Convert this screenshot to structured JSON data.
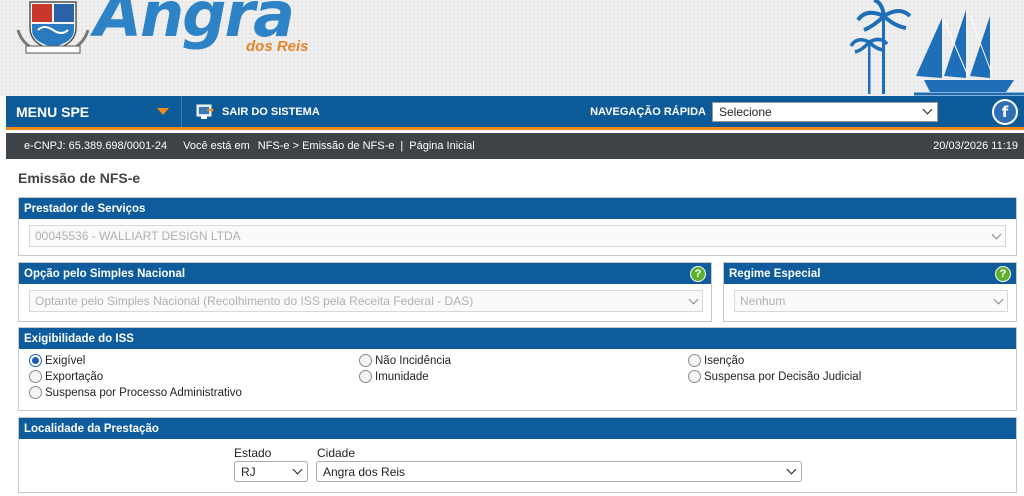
{
  "brand": {
    "name": "Angra",
    "subtitle": "dos Reis"
  },
  "nav": {
    "menu_label": "MENU SPE",
    "logout_label": "SAIR DO SISTEMA",
    "quick_nav_label": "NAVEGAÇÃO RÁPIDA",
    "quick_nav_value": "Selecione"
  },
  "status": {
    "cnpj": "e-CNPJ: 65.389.698/0001-24",
    "you_are_in": "Você está em",
    "breadcrumb": "NFS-e > Emissão de NFS-e",
    "separator": "|",
    "home": "Página Inicial",
    "datetime": "20/03/2026 11:19"
  },
  "page": {
    "title": "Emissão de NFS-e"
  },
  "prestador": {
    "heading": "Prestador de Serviços",
    "value": "00045536 - WALLIART DESIGN LTDA"
  },
  "simples": {
    "heading": "Opção pelo Simples Nacional",
    "value": "Optante pelo Simples Nacional (Recolhimento do ISS pela Receita Federal - DAS)"
  },
  "regime": {
    "heading": "Regime Especial",
    "value": "Nenhum"
  },
  "exigibilidade": {
    "heading": "Exigibilidade do ISS",
    "options": [
      {
        "label": "Exigível",
        "selected": true
      },
      {
        "label": "Não Incidência",
        "selected": false
      },
      {
        "label": "Isenção",
        "selected": false
      },
      {
        "label": "Exportação",
        "selected": false
      },
      {
        "label": "Imunidade",
        "selected": false
      },
      {
        "label": "Suspensa por Decisão Judicial",
        "selected": false
      },
      {
        "label": "Suspensa por Processo Administrativo",
        "selected": false
      }
    ]
  },
  "localidade": {
    "heading": "Localidade da Prestação",
    "estado_label": "Estado",
    "estado_value": "RJ",
    "cidade_label": "Cidade",
    "cidade_value": "Angra dos Reis"
  },
  "colors": {
    "primary": "#0e5c9c",
    "accent": "#f28a1b",
    "dark_bar": "#3e4348",
    "help": "#5fb02e"
  }
}
